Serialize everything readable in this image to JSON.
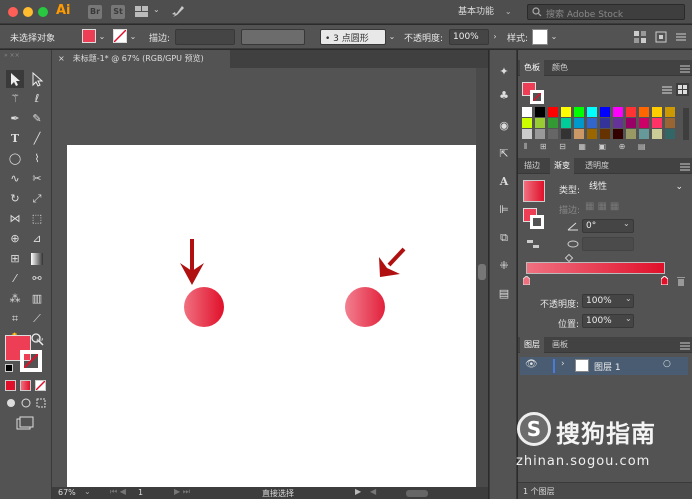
{
  "app": {
    "logo": "Ai",
    "bridge_icon": "bridge-icon",
    "stock_button": "St",
    "workspace": "基本功能",
    "search_placeholder": "搜索 Adobe Stock",
    "window_controls": [
      "#ff5f57",
      "#febc2e",
      "#28c840"
    ]
  },
  "control_bar": {
    "selection": "未选择对象",
    "stroke_label": "描边:",
    "brush": "3 点圆形",
    "opacity_label": "不透明度:",
    "opacity_value": "100%",
    "style_label": "样式:"
  },
  "document": {
    "tab_title": "未标题-1* @ 67% (RGB/GPU 预览)",
    "close_glyph": "×"
  },
  "status_bar": {
    "zoom": "67%",
    "artboard": "1",
    "tool": "直接选择"
  },
  "fill_color": "#ee3e56",
  "stroke_color": "#ffffff",
  "panels": {
    "swatches_tabs": [
      "色板",
      "颜色"
    ],
    "gradient_tabs": [
      "描边",
      "渐变",
      "透明度"
    ],
    "gradient": {
      "type_label": "类型:",
      "type_value": "线性",
      "stroke_label": "描边:",
      "angle_value": "0°",
      "start_color": "#f07080",
      "end_color": "#e0102a",
      "opacity_label": "不透明度:",
      "opacity_value": "100%",
      "location_label": "位置:",
      "location_value": "100%"
    },
    "layers_tabs": [
      "图层",
      "画板"
    ],
    "layers": [
      {
        "name": "图层 1",
        "color": "#4a7bd8"
      }
    ],
    "layers_footer": "1 个图层"
  },
  "swatches": [
    "#ffffff",
    "#000000",
    "#ff0000",
    "#ffff00",
    "#00ff00",
    "#00ffff",
    "#0000ff",
    "#ff00ff",
    "#ff3333",
    "#ff6600",
    "#ffcc00",
    "#cc9900",
    "#ccff00",
    "#99cc33",
    "#339933",
    "#00cc99",
    "#0099cc",
    "#3366cc",
    "#333399",
    "#663399",
    "#990066",
    "#cc0066",
    "#ff3366",
    "#996633",
    "#cccccc",
    "#999999",
    "#666666",
    "#333333",
    "#cc9966",
    "#996600",
    "#663300",
    "#330000",
    "#999966",
    "#669999",
    "#cccc99",
    "#336666"
  ],
  "watermark": {
    "brand": "搜狗指南",
    "url": "zhinan.sogou.com"
  }
}
